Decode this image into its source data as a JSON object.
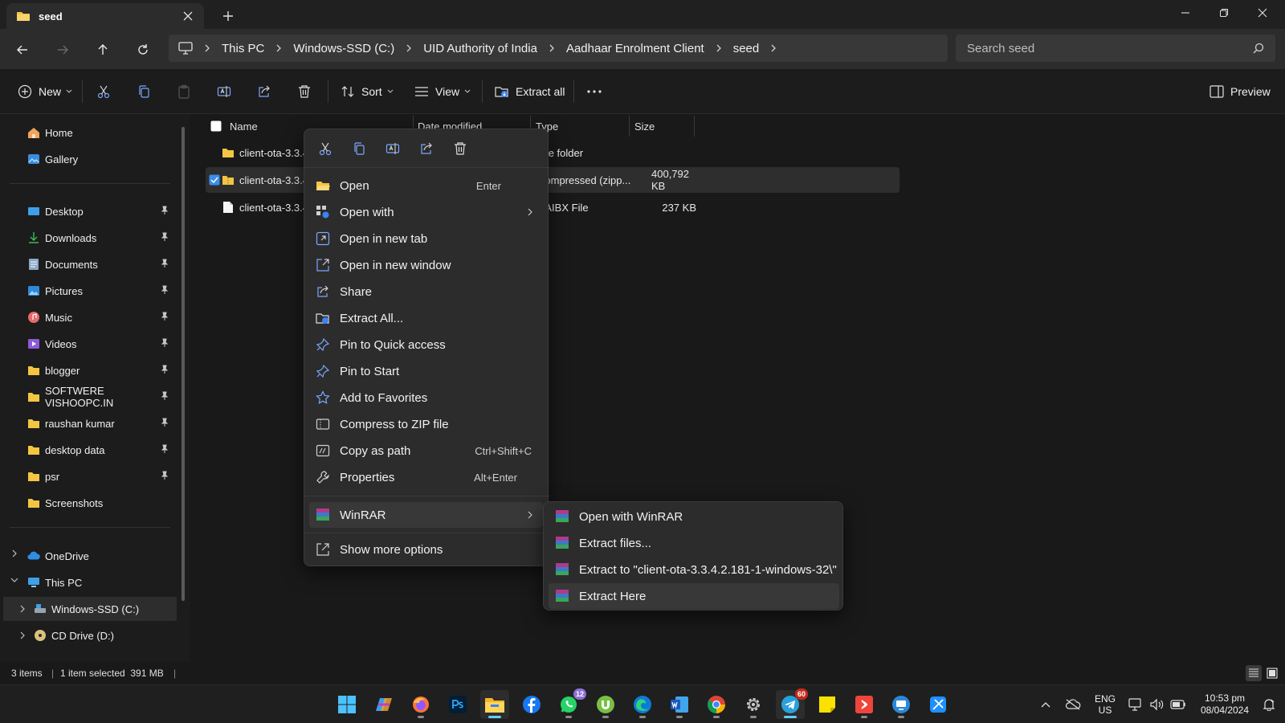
{
  "window": {
    "tab_title": "seed",
    "search_placeholder": "Search seed"
  },
  "breadcrumb": [
    "This PC",
    "Windows-SSD (C:)",
    "UID Authority of India",
    "Aadhaar Enrolment Client",
    "seed"
  ],
  "toolbar": {
    "new_label": "New",
    "sort_label": "Sort",
    "view_label": "View",
    "extract_all_label": "Extract all",
    "preview_label": "Preview"
  },
  "sidebar": {
    "home": "Home",
    "gallery": "Gallery",
    "quick": [
      "Desktop",
      "Downloads",
      "Documents",
      "Pictures",
      "Music",
      "Videos",
      "blogger",
      "SOFTWERE VISHOOPC.IN",
      "raushan kumar",
      "desktop data",
      "psr",
      "Screenshots"
    ],
    "onedrive": "OneDrive",
    "thispc": "This PC",
    "drive_c": "Windows-SSD (C:)",
    "drive_d": "CD Drive (D:)"
  },
  "columns": {
    "name": "Name",
    "date": "Date modified",
    "type": "Type",
    "size": "Size"
  },
  "files": [
    {
      "name": "client-ota-3.3.4",
      "type": "File folder",
      "size": ""
    },
    {
      "name": "client-ota-3.3.4",
      "type": "Compressed (zipp...",
      "size": "400,792 KB"
    },
    {
      "name": "client-ota-3.3.4",
      "type": "CAIBX File",
      "size": "237 KB"
    }
  ],
  "context_menu": {
    "items": [
      {
        "label": "Open",
        "shortcut": "Enter"
      },
      {
        "label": "Open with",
        "shortcut": ""
      },
      {
        "label": "Open in new tab",
        "shortcut": ""
      },
      {
        "label": "Open in new window",
        "shortcut": ""
      },
      {
        "label": "Share",
        "shortcut": ""
      },
      {
        "label": "Extract All...",
        "shortcut": ""
      },
      {
        "label": "Pin to Quick access",
        "shortcut": ""
      },
      {
        "label": "Pin to Start",
        "shortcut": ""
      },
      {
        "label": "Add to Favorites",
        "shortcut": ""
      },
      {
        "label": "Compress to ZIP file",
        "shortcut": ""
      },
      {
        "label": "Copy as path",
        "shortcut": "Ctrl+Shift+C"
      },
      {
        "label": "Properties",
        "shortcut": "Alt+Enter"
      }
    ],
    "winrar": "WinRAR",
    "show_more": "Show more options"
  },
  "winrar_submenu": [
    "Open with WinRAR",
    "Extract files...",
    "Extract to \"client-ota-3.3.4.2.181-1-windows-32\\\"",
    "Extract Here"
  ],
  "status": {
    "items_count": "3 items",
    "selected": "1 item selected  391 MB"
  },
  "taskbar": {
    "whatsapp_badge": "12",
    "telegram_badge": "60",
    "lang_top": "ENG",
    "lang_bottom": "US",
    "time": "10:53 pm",
    "date": "08/04/2024"
  },
  "colors": {
    "accent": "#60cdff",
    "folder": "#f4c542",
    "selection": "#2e2e2e"
  }
}
